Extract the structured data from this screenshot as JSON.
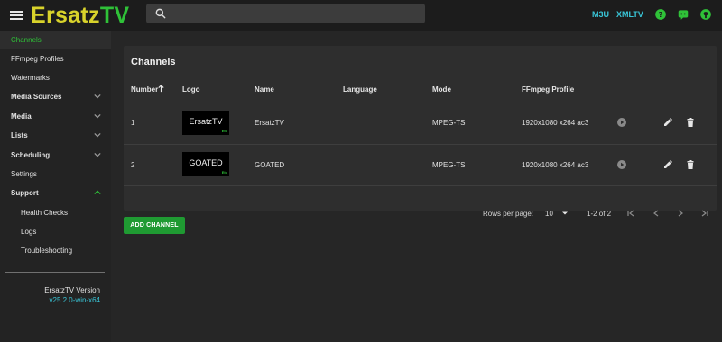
{
  "app": {
    "title_part1": "Ersatz",
    "title_part2": "TV",
    "search_placeholder": "",
    "links": [
      "M3U",
      "XMLTV"
    ],
    "accent_color": "#39c6d8",
    "primary_color": "#1f9a32"
  },
  "sidebar": {
    "items": [
      {
        "label": "Channels"
      },
      {
        "label": "FFmpeg Profiles"
      },
      {
        "label": "Watermarks"
      },
      {
        "label": "Media Sources"
      },
      {
        "label": "Media"
      },
      {
        "label": "Lists"
      },
      {
        "label": "Scheduling"
      },
      {
        "label": "Settings"
      },
      {
        "label": "Support"
      },
      {
        "label": "Health Checks"
      },
      {
        "label": "Logs"
      },
      {
        "label": "Troubleshooting"
      }
    ],
    "version_label": "ErsatzTV Version",
    "version_value": "v25.2.0-win-x64"
  },
  "channels": {
    "title": "Channels",
    "columns": [
      "Number",
      "Logo",
      "Name",
      "Language",
      "Mode",
      "FFmpeg Profile"
    ],
    "rows": [
      {
        "number": "1",
        "logo_text": "ErsatzTV",
        "logo_mark": "Etv",
        "name": "ErsatzTV",
        "language": "",
        "mode": "MPEG-TS",
        "profile": "1920x1080 x264 ac3"
      },
      {
        "number": "2",
        "logo_text": "GOATED",
        "logo_mark": "Etv",
        "name": "GOATED",
        "language": "",
        "mode": "MPEG-TS",
        "profile": "1920x1080 x264 ac3"
      }
    ],
    "rows_per_page_label": "Rows per page:",
    "rows_per_page_value": "10",
    "range": "1-2 of 2"
  },
  "add_button": "ADD CHANNEL"
}
